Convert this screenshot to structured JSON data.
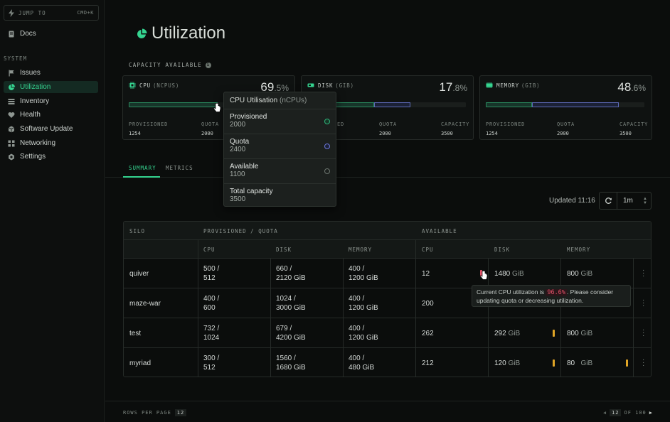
{
  "sidebar": {
    "jump_label": "JUMP TO",
    "jump_shortcut": "CMD+K",
    "docs": "Docs",
    "section": "SYSTEM",
    "items": [
      {
        "label": "Issues",
        "icon": "flag-icon"
      },
      {
        "label": "Utilization",
        "icon": "pie-chart-icon",
        "active": true
      },
      {
        "label": "Inventory",
        "icon": "list-icon"
      },
      {
        "label": "Health",
        "icon": "heart-icon"
      },
      {
        "label": "Software Update",
        "icon": "cube-icon"
      },
      {
        "label": "Networking",
        "icon": "network-icon"
      },
      {
        "label": "Settings",
        "icon": "gear-icon"
      }
    ]
  },
  "page": {
    "title": "Utilization",
    "capacity_label": "CAPACITY AVAILABLE",
    "info_glyph": "i"
  },
  "cards": [
    {
      "name": "CPU",
      "unit": "(NCPUS)",
      "pct_int": "69",
      "pct_dec": ".5%",
      "stats": [
        {
          "label": "PROVISIONED",
          "value": "1254"
        },
        {
          "label": "QUOTA",
          "value": "2000"
        }
      ],
      "provisioned_fraction": 0.36,
      "quota_fraction": 0.57
    },
    {
      "name": "DISK",
      "unit": "(GIB)",
      "pct_int": "17",
      "pct_dec": ".8%",
      "stats": [
        {
          "label": "PROVISIONED",
          "value": ""
        },
        {
          "label": "QUOTA",
          "value": "2000"
        },
        {
          "label": "CAPACITY",
          "value": "3500"
        }
      ],
      "provisioned_fraction": 0.36,
      "quota_fraction": 0.57
    },
    {
      "name": "MEMORY",
      "unit": "(GIB)",
      "pct_int": "48",
      "pct_dec": ".6%",
      "stats": [
        {
          "label": "PROVISIONED",
          "value": "1254"
        },
        {
          "label": "QUOTA",
          "value": "2000"
        },
        {
          "label": "CAPACITY",
          "value": "3500"
        }
      ],
      "provisioned_fraction": 0.36,
      "quota_fraction": 0.57
    }
  ],
  "disk_stat_partial": "ED",
  "popover": {
    "title": "CPU Utilisation",
    "unit": "(nCPUs)",
    "rows": [
      {
        "label": "Provisioned",
        "value": "2000",
        "color": "#2fb37a"
      },
      {
        "label": "Quota",
        "value": "2400",
        "color": "#6b76d6"
      },
      {
        "label": "Available",
        "value": "1100",
        "color": "#6c756f"
      },
      {
        "label": "Total capacity",
        "value": "3500",
        "color": ""
      }
    ]
  },
  "tabs": [
    {
      "label": "SUMMARY",
      "active": true
    },
    {
      "label": "METRICS",
      "active": false
    }
  ],
  "toolbar": {
    "updated": "Updated 11:16",
    "interval": "1m"
  },
  "table": {
    "header_groups": [
      "SILO",
      "PROVISIONED / QUOTA",
      "AVAILABLE"
    ],
    "columns": [
      "CPU",
      "DISK",
      "MEMORY",
      "CPU",
      "DISK",
      "MEMORY"
    ],
    "rows": [
      {
        "silo": "quiver",
        "cpu": [
          "500 /",
          "512"
        ],
        "disk": [
          "660 /",
          "2120 GiB"
        ],
        "mem": [
          "400 /",
          "1200 GiB"
        ],
        "a_cpu": "12",
        "a_disk": "1480",
        "a_mem": "800"
      },
      {
        "silo": "maze-war",
        "cpu": [
          "400 /",
          "600"
        ],
        "disk": [
          "1024 /",
          "3000 GiB"
        ],
        "mem": [
          "400 /",
          "1200 GiB"
        ],
        "a_cpu": "200",
        "a_disk": "",
        "a_mem": ""
      },
      {
        "silo": "test",
        "cpu": [
          "732 /",
          "1024"
        ],
        "disk": [
          "679 /",
          "4200 GiB"
        ],
        "mem": [
          "400 /",
          "1200 GiB"
        ],
        "a_cpu": "262",
        "a_disk": "292",
        "a_mem": "800"
      },
      {
        "silo": "myriad",
        "cpu": [
          "300 /",
          "512"
        ],
        "disk": [
          "1560 /",
          "1680 GiB"
        ],
        "mem": [
          "400 /",
          "480 GiB"
        ],
        "a_cpu": "212",
        "a_disk": "120",
        "a_mem": "80"
      }
    ],
    "gib": "GiB"
  },
  "tooltip": {
    "prefix": "Current CPU utilization is",
    "value": "96.6%",
    "suffix": ". Please consider updating quota or decreasing utilization."
  },
  "footer": {
    "rows_label": "ROWS PER PAGE",
    "rows_value": "12",
    "page_value": "12",
    "page_of": "OF 100"
  },
  "colors": {
    "accent": "#35d490",
    "warn": "#e0a526",
    "danger": "#e4536a"
  }
}
